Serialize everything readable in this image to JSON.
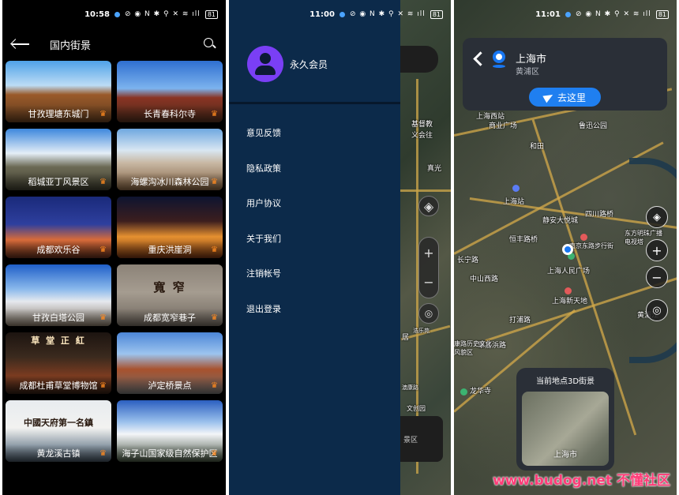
{
  "panel1": {
    "status": {
      "time": "10:58",
      "icons": "⊘ ◉ N ✱ ⚲ ✕ ≋ ıll",
      "battery": "81"
    },
    "title": "国内街景",
    "tiles": [
      {
        "name": "甘孜理塘东城门",
        "premium": true,
        "mark": ""
      },
      {
        "name": "长青春科尔寺",
        "premium": true,
        "mark": ""
      },
      {
        "name": "稻城亚丁风景区",
        "premium": true,
        "mark": ""
      },
      {
        "name": "海螺沟冰川森林公园",
        "premium": true,
        "mark": ""
      },
      {
        "name": "成都欢乐谷",
        "premium": true,
        "mark": ""
      },
      {
        "name": "重庆洪崖洞",
        "premium": true,
        "mark": ""
      },
      {
        "name": "甘孜白塔公园",
        "premium": true,
        "mark": ""
      },
      {
        "name": "成都宽窄巷子",
        "premium": true,
        "mark": "寬  窄"
      },
      {
        "name": "成都杜甫草堂博物馆",
        "premium": true,
        "mark": "草 堂 正 紅"
      },
      {
        "name": "泸定桥景点",
        "premium": true,
        "mark": ""
      },
      {
        "name": "黄龙溪古镇",
        "premium": true,
        "mark": "中國天府第一名鎮"
      },
      {
        "name": "海子山国家级自然保护区",
        "premium": true,
        "mark": ""
      }
    ]
  },
  "panel2": {
    "status": {
      "time": "11:00",
      "icons": "⊘ ◉ N ✱ ⚲ ✕ ≋ ıll",
      "battery": "81"
    },
    "member_label": "永久会员",
    "menu": [
      "意见反馈",
      "隐私政策",
      "用户协议",
      "关于我们",
      "注销帐号",
      "退出登录"
    ],
    "map_peek_labels": [
      "基督教",
      "义会往",
      "真光",
      "居",
      "浩乐苑",
      "澳康路",
      "文创园",
      "景区"
    ]
  },
  "panel3": {
    "status": {
      "time": "11:01",
      "icons": "⊘ ◉ N ✱ ⚲ ✕ ≋ ıll",
      "battery": "81"
    },
    "city": "上海市",
    "district": "黄浦区",
    "go_label": "去这里",
    "view_title": "当前地点3D街景",
    "thumb_label": "上海市",
    "map_labels": [
      "上海西站",
      "商业广场",
      "和田",
      "鲁迅公园",
      "上海站",
      "静安大悦城",
      "四川路桥",
      "恒丰路桥",
      "南京东路步行街",
      "上海人民广场",
      "东方明珠广播电视塔",
      "上海新天地",
      "长宁路",
      "中山西路",
      "打浦路",
      "肇嘉浜路",
      "康路历史文化风貌区",
      "龙华寺",
      "黄浦江"
    ],
    "watermark": "www.budog.net 不懂社区"
  }
}
